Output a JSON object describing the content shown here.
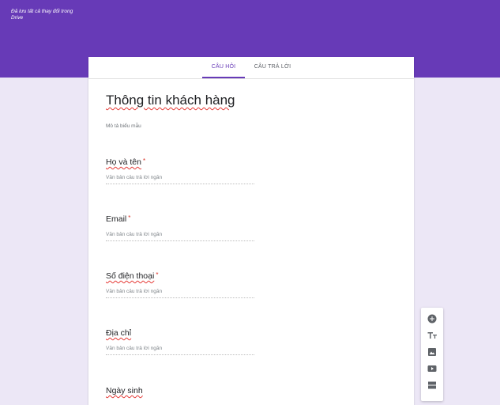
{
  "header": {
    "save_status_line1": "Đã lưu tất cả thay đổi trong",
    "save_status_line2": "Drive"
  },
  "tabs": {
    "questions": "CÂU HỎI",
    "responses": "CÂU TRẢ LỜI"
  },
  "form": {
    "title": "Thông tin khách hàng",
    "description": "Mô tả biểu mẫu",
    "questions": [
      {
        "label": "Họ và tên",
        "required": "*",
        "placeholder": "Văn bản câu trả lời ngắn"
      },
      {
        "label": "Email",
        "required": "*",
        "placeholder": "Văn bản câu trả lời ngắn"
      },
      {
        "label": "Số điện thoại",
        "required": "*",
        "placeholder": "Văn bản câu trả lời ngắn"
      },
      {
        "label": "Địa chỉ",
        "required": "",
        "placeholder": "Văn bản câu trả lời ngắn"
      },
      {
        "label": "Ngày sinh",
        "required": "",
        "placeholder": ""
      }
    ]
  },
  "toolbar": {
    "icons": [
      "add-question-icon",
      "add-title-icon",
      "add-image-icon",
      "add-video-icon",
      "add-section-icon"
    ],
    "icon_color": "#5f6368"
  },
  "colors": {
    "header": "#673ab7",
    "background": "#ece7f6",
    "accent": "#673ab7",
    "required": "#d93025"
  }
}
